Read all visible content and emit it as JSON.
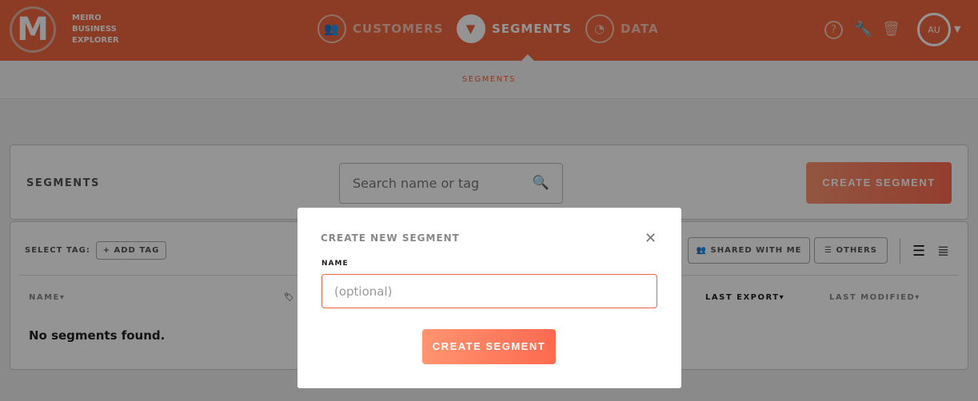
{
  "header": {
    "brand_lines": [
      "MEIRO",
      "BUSINESS",
      "EXPLORER"
    ],
    "logo_letter": "M",
    "nav": [
      {
        "label": "CUSTOMERS",
        "icon": "users-icon"
      },
      {
        "label": "SEGMENTS",
        "icon": "filter-icon",
        "active": true
      },
      {
        "label": "DATA",
        "icon": "gauge-icon"
      }
    ],
    "avatar": "AU"
  },
  "subnav": {
    "label": "SEGMENTS"
  },
  "segments_card": {
    "title": "SEGMENTS",
    "search_placeholder": "Search name or tag",
    "create_label": "CREATE SEGMENT"
  },
  "list": {
    "select_tag": "SELECT TAG:",
    "add_tag": "+ ADD TAG",
    "filters": [
      "SHARED WITH ME",
      "OTHERS"
    ],
    "columns": {
      "name": "NAME",
      "last_export": "LAST EXPORT",
      "last_modified": "LAST MODIFIED"
    },
    "empty": "No segments found."
  },
  "modal": {
    "title": "CREATE NEW SEGMENT",
    "name_label": "NAME",
    "name_placeholder": "(optional)",
    "name_value": "",
    "submit": "CREATE SEGMENT"
  },
  "colors": {
    "brand": "#f2663f"
  }
}
